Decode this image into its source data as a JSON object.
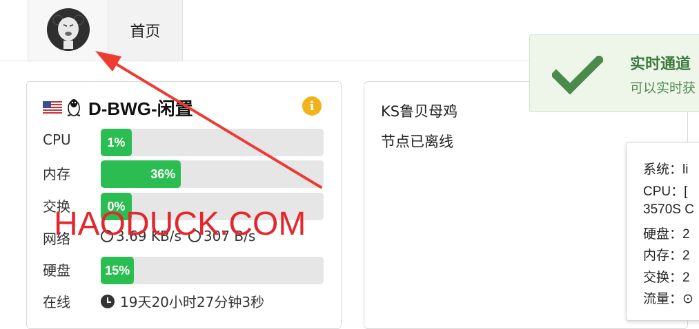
{
  "nav": {
    "home_label": "首页"
  },
  "server_card": {
    "flag_icon": "us-flag-icon",
    "os_icon": "linux-penguin-icon",
    "name": "D-BWG-闲置",
    "info_icon": "info-icon",
    "rows": {
      "cpu": {
        "label": "CPU",
        "value_text": "1%",
        "percent": 1
      },
      "memory": {
        "label": "内存",
        "value_text": "36%",
        "percent": 36
      },
      "swap": {
        "label": "交换",
        "value_text": "0%",
        "percent": 0
      },
      "network": {
        "label": "网络",
        "down": "3.69 KB/s",
        "up": "307 B/s"
      },
      "disk": {
        "label": "硬盘",
        "value_text": "15%",
        "percent": 15
      },
      "uptime": {
        "label": "在线",
        "value": "19天20小时27分钟3秒"
      }
    },
    "bar_color": "#2bbd52"
  },
  "offline_card": {
    "name": "KS鲁贝母鸡",
    "status": "节点已离线"
  },
  "toast": {
    "title": "实时通道",
    "message": "可以实时获",
    "icon": "checkmark-icon",
    "color": "#4a8a4a"
  },
  "popover": {
    "lines": [
      "系统：li",
      "CPU：[",
      "3570S C",
      "硬盘：2",
      "内存：2",
      "交换：2",
      "流量：⊙"
    ]
  },
  "watermark": "HAODUCK.COM",
  "annotation_color": "#ee3b32"
}
